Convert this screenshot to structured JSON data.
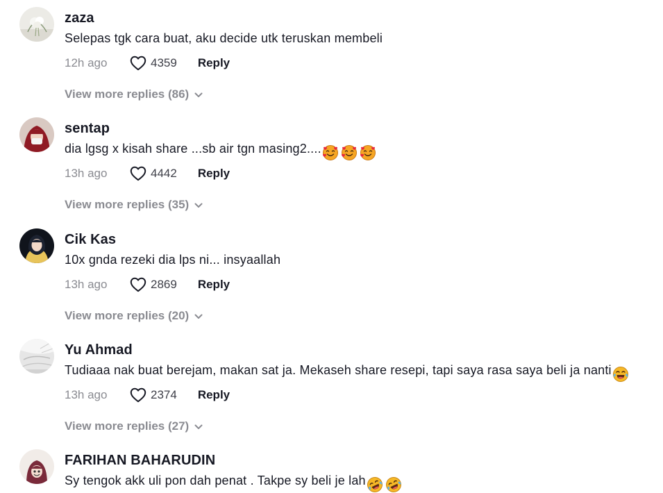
{
  "comments": [
    {
      "username": "zaza",
      "text": "Selepas tgk cara buat, aku decide utk teruskan membeli",
      "time": "12h ago",
      "likes": "4359",
      "reply_label": "Reply",
      "view_more": "View more replies (86)"
    },
    {
      "username": "sentap",
      "text": "dia lgsg x kisah share ...sb air tgn masing2....",
      "emoji_icons": [
        "smiling-face-with-hearts",
        "smiling-face-with-hearts",
        "smiling-face-with-hearts"
      ],
      "time": "13h ago",
      "likes": "4442",
      "reply_label": "Reply",
      "view_more": "View more replies (35)"
    },
    {
      "username": "Cik Kas",
      "text": "10x gnda rezeki dia lps ni... insyaallah",
      "time": "13h ago",
      "likes": "2869",
      "reply_label": "Reply",
      "view_more": "View more replies (20)"
    },
    {
      "username": "Yu Ahmad",
      "text": "Tudiaaa nak buat berejam, makan sat ja. Mekaseh share resepi, tapi saya rasa saya beli ja nanti",
      "emoji_icons": [
        "face-with-tears-of-joy"
      ],
      "time": "13h ago",
      "likes": "2374",
      "reply_label": "Reply",
      "view_more": "View more replies (27)"
    },
    {
      "username": "FARIHAN BAHARUDIN",
      "text": "Sy tengok akk uli pon dah penat . Takpe sy beli je lah",
      "emoji_icons": [
        "rolling-on-the-floor-laughing",
        "rolling-on-the-floor-laughing"
      ]
    }
  ],
  "colors": {
    "username": "#161823",
    "body_text": "#161823",
    "muted": "#8a8b91",
    "like_count": "#3d3e47"
  },
  "icons": {
    "like": "heart-outline-icon",
    "expand": "chevron-down-icon"
  }
}
